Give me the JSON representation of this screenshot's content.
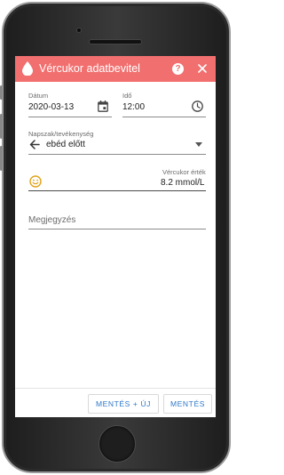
{
  "app": {
    "title": "Vércukor adatbevitel",
    "accent_color": "#f16f6f",
    "header_icons": [
      "blood-drop-icon",
      "help-icon",
      "close-icon"
    ],
    "help_glyph": "?"
  },
  "form": {
    "date_label": "Dátum",
    "date_value": "2020-03-13",
    "time_label": "Idő",
    "time_value": "12:00",
    "period_label": "Napszak/tevékenység",
    "period_value": "ebéd előtt",
    "glucose_label": "Vércukor érték",
    "glucose_value": "8.2 mmol/L",
    "note_placeholder": "Megjegyzés"
  },
  "actions": {
    "save_new_label": "MENTÉS + ÚJ",
    "save_label": "MENTÉS"
  }
}
